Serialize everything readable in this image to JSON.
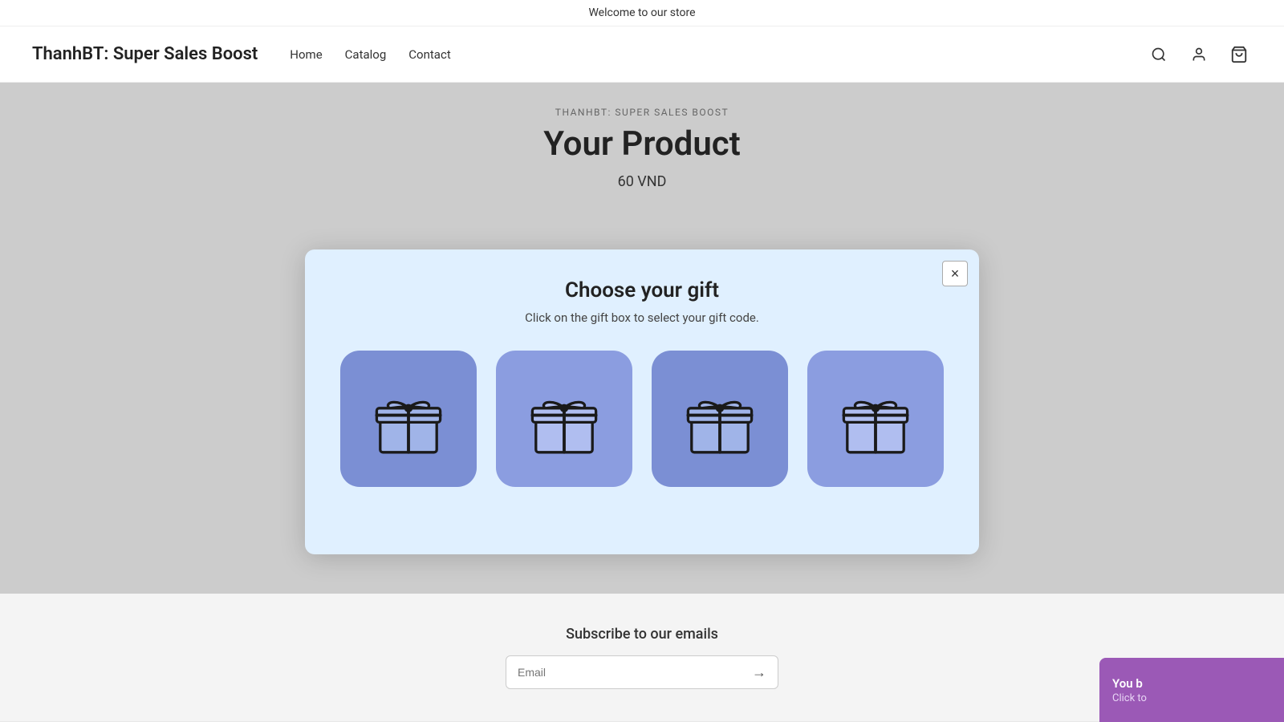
{
  "announcement": {
    "text": "Welcome to our store"
  },
  "header": {
    "logo": "ThanhBT: Super Sales Boost",
    "nav": [
      {
        "label": "Home",
        "href": "#"
      },
      {
        "label": "Catalog",
        "href": "#"
      },
      {
        "label": "Contact",
        "href": "#"
      }
    ],
    "icons": {
      "search": "🔍",
      "login": "👤",
      "cart": "🛒"
    }
  },
  "product": {
    "vendor": "THANHBT: SUPER SALES BOOST",
    "title": "Your Product",
    "price": "60 VND"
  },
  "modal": {
    "title": "Choose your gift",
    "subtitle": "Click on the gift box to select your gift code.",
    "close_label": "×",
    "gifts": [
      {
        "id": 1
      },
      {
        "id": 2
      },
      {
        "id": 3
      },
      {
        "id": 4
      }
    ]
  },
  "footer": {
    "subscribe_title": "Subscribe to our emails",
    "email_placeholder": "Email",
    "submit_arrow": "→"
  },
  "corner_widget": {
    "title": "You b",
    "subtitle": "Click to"
  }
}
